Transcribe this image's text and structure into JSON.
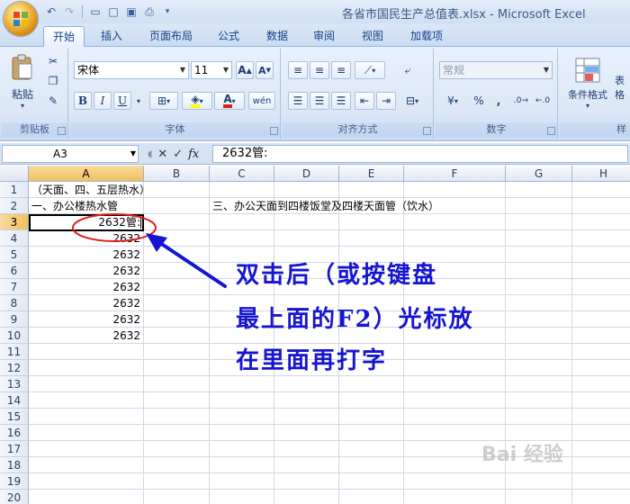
{
  "window": {
    "title": "各省市国民生产总值表.xlsx - Microsoft Excel"
  },
  "ribbon": {
    "tabs": [
      "开始",
      "插入",
      "页面布局",
      "公式",
      "数据",
      "审阅",
      "视图",
      "加载项"
    ],
    "active_tab": "开始",
    "clipboard": {
      "paste_label": "粘贴",
      "group_label": "剪贴板"
    },
    "font": {
      "name": "宋体",
      "size": "11",
      "bold": "B",
      "italic": "I",
      "underline": "U",
      "group_label": "字体",
      "font_color": "#e02020",
      "fill_color": "#ffff00"
    },
    "alignment": {
      "group_label": "对齐方式"
    },
    "number": {
      "format": "常规",
      "percent": "%",
      "comma": ",",
      "group_label": "数字"
    },
    "styles": {
      "conditional_format_label": "条件格式",
      "table_format_partial": "表格",
      "group_label_partial": "样"
    }
  },
  "formula_bar": {
    "name_box": "A3",
    "fx_label": "fx",
    "content": "2632管:"
  },
  "sheet": {
    "columns": [
      "A",
      "B",
      "C",
      "D",
      "E",
      "F",
      "G",
      "H"
    ],
    "selected_column": "A",
    "rows": [
      "1",
      "2",
      "3",
      "4",
      "5",
      "6",
      "7",
      "8",
      "9",
      "10",
      "11",
      "12",
      "13",
      "14",
      "15",
      "16",
      "17",
      "18",
      "19",
      "20"
    ],
    "selected_row": "3",
    "cells": {
      "A1": "（天面、四、五层热水）",
      "A2": "一、办公楼热水管",
      "C2": "三、办公天面到四楼饭堂及四楼天面管（饮水）",
      "A3": "2632管:",
      "A4": "2632",
      "A5": "2632",
      "A6": "2632",
      "A7": "2632",
      "A8": "2632",
      "A9": "2632",
      "A10": "2632"
    }
  },
  "annotation": {
    "line1": "双击后（或按键盘",
    "line2": "最上面的F2）光标放",
    "line3": "在里面再打字",
    "color": "#1515d0",
    "highlight_color": "#e02020"
  },
  "watermark": "Bai 经验"
}
